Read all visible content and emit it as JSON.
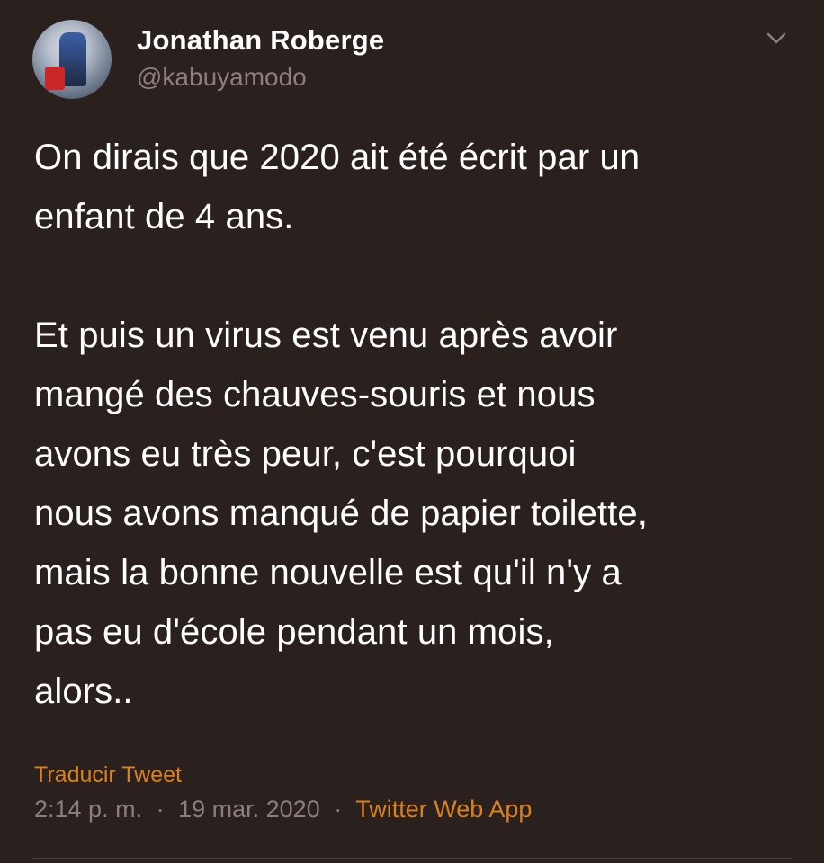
{
  "user": {
    "display_name": "Jonathan Roberge",
    "handle": "@kabuyamodo",
    "avatar_icon": "profile-photo"
  },
  "tweet": {
    "text": "On dirais que 2020 ait été écrit par un\nenfant de 4 ans.\n\nEt puis un virus est venu après avoir\nmangé des chauves-souris et nous\navons eu très peur, c'est pourquoi\nnous avons manqué de papier toilette,\nmais la bonne nouvelle est qu'il n'y a\npas eu d'école pendant un mois,\nalors..",
    "translate_label": "Traducir Tweet"
  },
  "meta": {
    "time": "2:14 p. m.",
    "date": "19 mar. 2020",
    "separator": "·",
    "source": "Twitter Web App"
  },
  "colors": {
    "background": "#2a201e",
    "text": "#ffffff",
    "muted": "#8a7f7a",
    "accent": "#d9801f"
  },
  "icons": {
    "menu": "chevron-down-icon"
  }
}
